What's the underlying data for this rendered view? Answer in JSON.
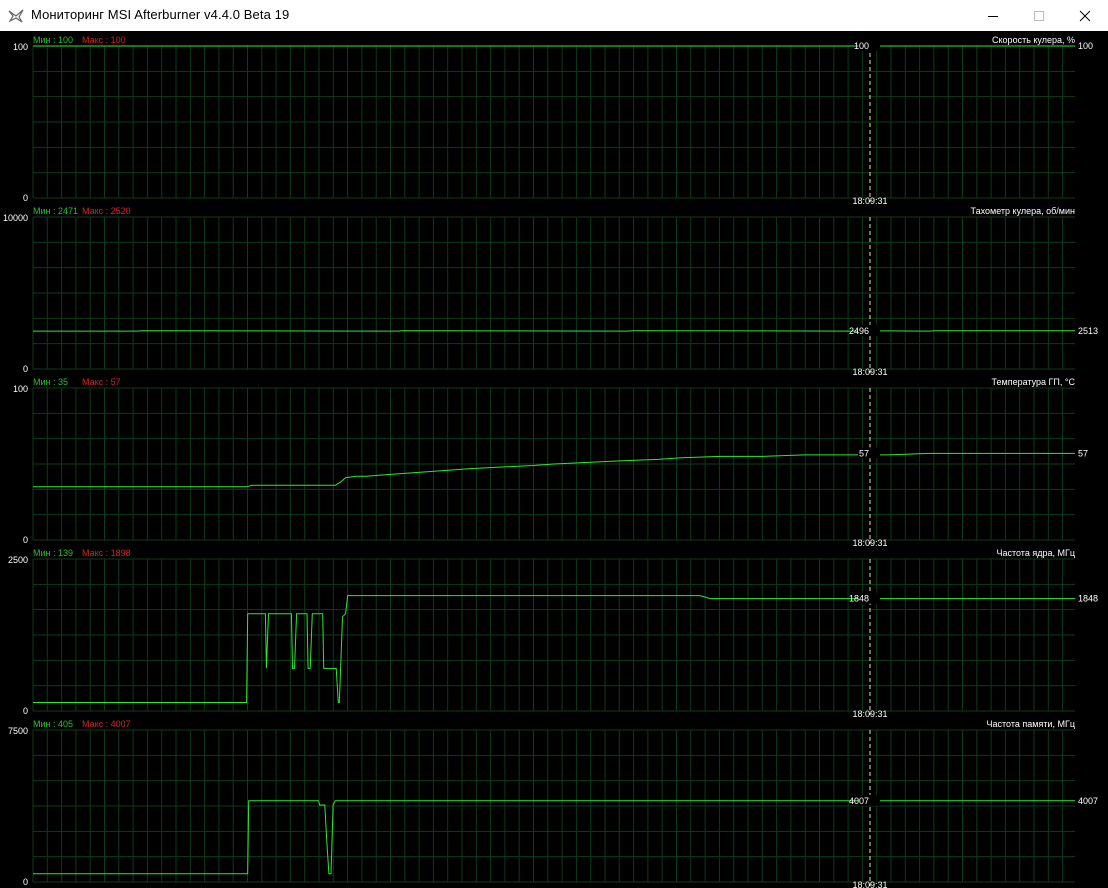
{
  "window": {
    "title": "Мониторинг MSI Afterburner v4.4.0 Beta 19",
    "icon": "afterburner-logo-icon"
  },
  "controls": {
    "minimize": "minimize-icon",
    "maximize": "maximize-icon",
    "close": "close-icon"
  },
  "time_label": "18:09:31",
  "colors": {
    "background": "#000000",
    "grid": "#0b3d16",
    "line": "#2ee82e",
    "min_text": "#25c225",
    "max_text": "#d02525",
    "label_text": "#ffffff",
    "cursor": "#f0e68c"
  },
  "chart_data": [
    {
      "type": "line",
      "title": "Скорость кулера, %",
      "min_label": "Мин : 100",
      "max_label": "Макс : 100",
      "ymin": 0,
      "ymax": 100,
      "ymax_label": "100",
      "ymin_label": "0",
      "cursor_value": "100",
      "current_value": "100",
      "x": [
        0,
        100
      ],
      "y": [
        100,
        100
      ]
    },
    {
      "type": "line",
      "title": "Тахометр кулера, об/мин",
      "min_label": "Мин : 2471",
      "max_label": "Макс : 2520",
      "ymin": 0,
      "ymax": 10000,
      "ymax_label": "10000",
      "ymin_label": "0",
      "cursor_value": "2496",
      "current_value": "2513",
      "x": [
        0,
        10,
        10.5,
        35,
        35.5,
        57,
        57.5,
        79,
        79.5,
        86,
        86.5,
        100
      ],
      "y": [
        2496,
        2496,
        2520,
        2496,
        2520,
        2496,
        2520,
        2496,
        2520,
        2496,
        2520,
        2513
      ]
    },
    {
      "type": "line",
      "title": "Температура ГП, °C",
      "min_label": "Мин : 35",
      "max_label": "Макс : 57",
      "ymin": 0,
      "ymax": 100,
      "ymax_label": "100",
      "ymin_label": "0",
      "cursor_value": "57",
      "current_value": "57",
      "x": [
        0,
        20.5,
        21,
        23,
        24,
        27,
        28,
        29,
        29.5,
        30,
        31,
        32,
        34,
        36,
        38,
        40,
        42,
        45,
        48,
        50,
        53,
        56,
        60,
        62,
        66,
        70,
        74,
        78,
        82,
        86,
        90,
        100
      ],
      "y": [
        35,
        35,
        36,
        36,
        36,
        36,
        36,
        36,
        38,
        41,
        42,
        42,
        43,
        44,
        45,
        46,
        47,
        48,
        49,
        50,
        51,
        52,
        53,
        54,
        55,
        55,
        56,
        56,
        56,
        57,
        57,
        57
      ]
    },
    {
      "type": "line",
      "title": "Частота ядра, МГц",
      "min_label": "Мин : 139",
      "max_label": "Макс : 1898",
      "ymin": 0,
      "ymax": 2500,
      "ymax_label": "2500",
      "ymin_label": "0",
      "cursor_value": "1848",
      "current_value": "1848",
      "x": [
        0,
        20.5,
        20.6,
        22.3,
        22.4,
        22.6,
        24.8,
        24.9,
        25.1,
        25.3,
        26.3,
        26.4,
        26.6,
        26.8,
        27.8,
        27.9,
        28.1,
        29.1,
        29.3,
        29.4,
        29.5,
        29.7,
        30.0,
        30.2,
        30.3,
        64,
        65,
        100
      ],
      "y": [
        139,
        139,
        1600,
        1600,
        700,
        1600,
        1600,
        700,
        700,
        1600,
        1600,
        700,
        700,
        1600,
        1600,
        700,
        700,
        700,
        139,
        139,
        600,
        1550,
        1600,
        1898,
        1898,
        1898,
        1848,
        1848
      ]
    },
    {
      "type": "line",
      "title": "Частота памяти, МГц",
      "min_label": "Мин : 405",
      "max_label": "Макс : 4007",
      "ymin": 0,
      "ymax": 7500,
      "ymax_label": "7500",
      "ymin_label": "0",
      "cursor_value": "4007",
      "current_value": "4007",
      "x": [
        0,
        20.6,
        20.7,
        27.4,
        27.5,
        28.0,
        28.2,
        28.4,
        28.6,
        28.8,
        29.0,
        100
      ],
      "y": [
        405,
        405,
        4007,
        4007,
        3800,
        3800,
        2000,
        405,
        405,
        3800,
        4007,
        4007
      ]
    }
  ]
}
